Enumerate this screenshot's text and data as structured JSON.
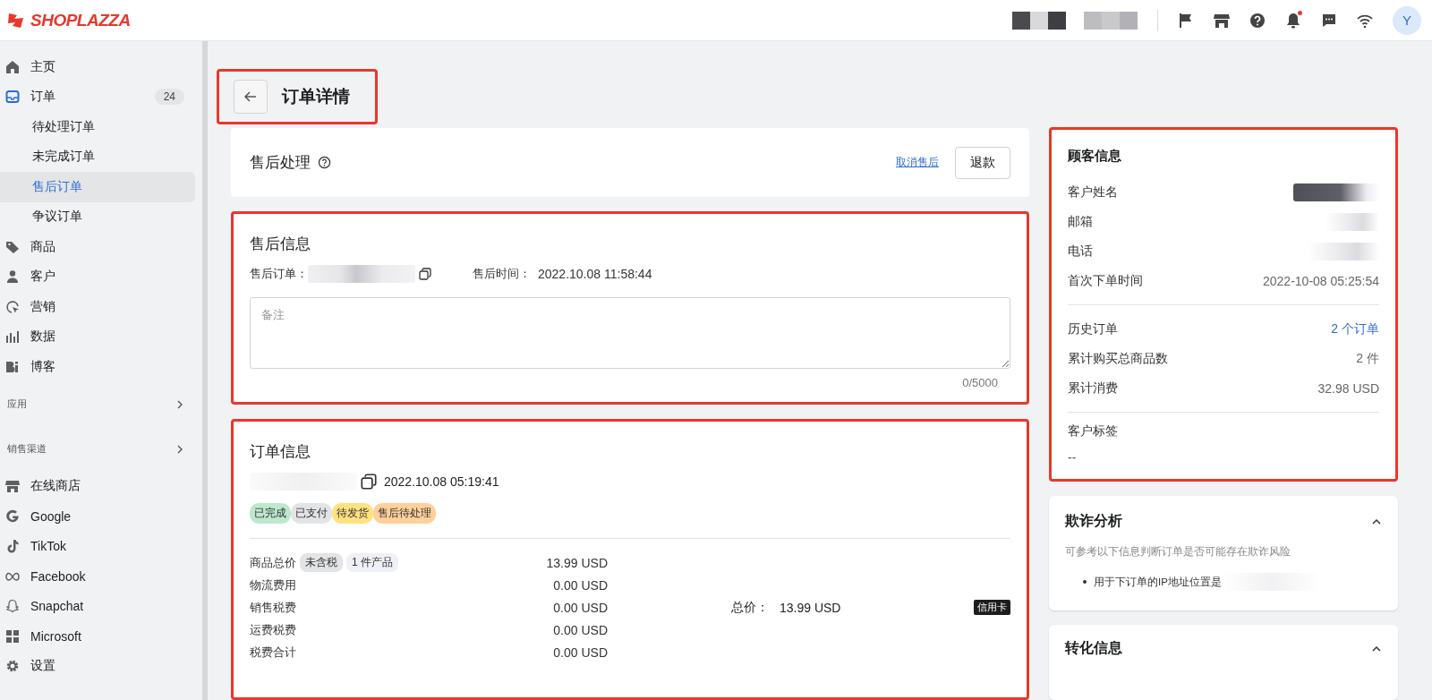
{
  "topbar": {
    "logo": "SHOPLAZZA",
    "avatar": "Y",
    "bell_dot": true
  },
  "sidebar": {
    "items": [
      {
        "kind": "item",
        "label": "主页",
        "selected": false
      },
      {
        "kind": "item",
        "label": "订单",
        "badge": "24",
        "selected": false,
        "children": [
          {
            "label": "待处理订单",
            "selected": false
          },
          {
            "label": "未完成订单",
            "selected": false
          },
          {
            "label": "售后订单",
            "selected": true
          },
          {
            "label": "争议订单",
            "selected": false
          }
        ]
      },
      {
        "kind": "item",
        "label": "商品",
        "selected": false
      },
      {
        "kind": "item",
        "label": "客户",
        "selected": false
      },
      {
        "kind": "item",
        "label": "营销",
        "selected": false
      },
      {
        "kind": "item",
        "label": "数据",
        "selected": false
      },
      {
        "kind": "item",
        "label": "博客",
        "selected": false
      },
      {
        "kind": "section",
        "label": "应用"
      },
      {
        "kind": "section",
        "label": "销售渠道"
      },
      {
        "kind": "item",
        "label": "在线商店",
        "selected": false
      },
      {
        "kind": "item",
        "label": "Google",
        "selected": false
      },
      {
        "kind": "item",
        "label": "TikTok",
        "selected": false
      },
      {
        "kind": "item",
        "label": "Facebook",
        "selected": false
      },
      {
        "kind": "item",
        "label": "Snapchat",
        "selected": false
      },
      {
        "kind": "item",
        "label": "Microsoft",
        "selected": false
      },
      {
        "kind": "item",
        "label": "设置",
        "selected": false
      }
    ]
  },
  "page": {
    "title": "订单详情",
    "highlighted": true
  },
  "aftersale_card": {
    "title": "售后处理",
    "link": "取消售后",
    "button": "退款",
    "highlighted": false
  },
  "aftersale_info": {
    "title": "售后信息",
    "order_label": "售后订单：",
    "time_label": "售后时间：",
    "time": "2022.10.08 11:58:44",
    "note": {
      "placeholder": "备注",
      "counter": "0/5000"
    },
    "highlighted": true
  },
  "order_info": {
    "title": "订单信息",
    "date": "2022.10.08 05:19:41",
    "highlighted": true,
    "tags": [
      {
        "label": "已完成",
        "color": "#bde8cc"
      },
      {
        "label": "已支付",
        "color": "#e3e4e6"
      },
      {
        "label": "待发货",
        "color": "#ffe27f"
      },
      {
        "label": "售后待处理",
        "color": "#ffd09b"
      }
    ],
    "rows": [
      {
        "label": "商品总价",
        "chips": [
          {
            "label": "未含税",
            "color": "#e3e4e6"
          },
          {
            "label": "1 件产品",
            "color": "#eef0f5"
          }
        ],
        "value": "13.99 USD"
      },
      {
        "label": "物流费用",
        "value": "0.00 USD"
      },
      {
        "label": "销售税费",
        "value": "0.00 USD"
      },
      {
        "label": "运费税费",
        "value": "0.00 USD"
      },
      {
        "label": "税费合计",
        "value": "0.00 USD"
      }
    ],
    "total_label": "总价：",
    "total": "13.99 USD",
    "payment": "信用卡"
  },
  "customer": {
    "title": "顾客信息",
    "highlighted": true,
    "fields": [
      {
        "label": "客户姓名",
        "kind": "redacted"
      },
      {
        "label": "邮箱",
        "kind": "redacted"
      },
      {
        "label": "电话",
        "kind": "redacted"
      },
      {
        "label": "首次下单时间",
        "kind": "text",
        "value": "2022-10-08 05:25:54"
      }
    ],
    "stats": [
      {
        "label": "历史订单",
        "kind": "link",
        "value": "2 个订单"
      },
      {
        "label": "累计购买总商品数",
        "kind": "text",
        "value": "2 件"
      },
      {
        "label": "累计消费",
        "kind": "text",
        "value": "32.98 USD"
      }
    ],
    "tags_label": "客户标签",
    "tags_value": "--"
  },
  "fraud": {
    "title": "欺诈分析",
    "expanded": true,
    "description": "可参考以下信息判断订单是否可能存在欺诈风险",
    "bullets": [
      "用于下订单的IP地址位置是"
    ]
  },
  "conversion": {
    "title": "转化信息",
    "expanded": true
  }
}
